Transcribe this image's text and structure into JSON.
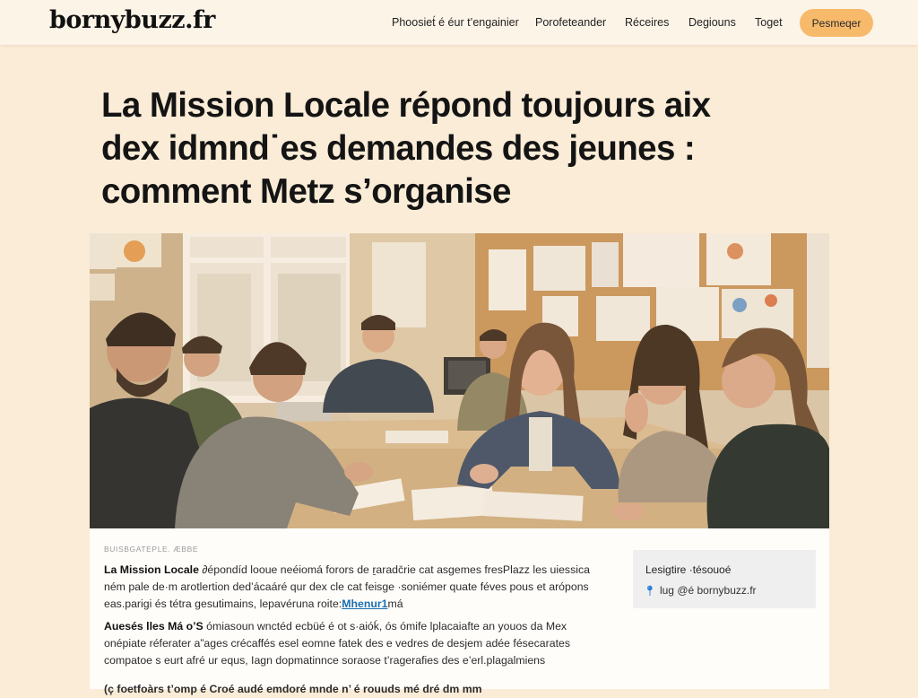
{
  "site": {
    "logo": "bornybuzz.fr"
  },
  "nav": {
    "items": [
      "Phoosiet́ é éur t’engainier",
      "Porofeteander",
      "Réceires",
      "Degiouns",
      "Toget"
    ],
    "cta": "Pesmeqer"
  },
  "article": {
    "title_lines": [
      "La Mission Locale répond toujours aix",
      "dex idmnd˙es demandes des jeunes :",
      "comment Metz s’organise"
    ],
    "image_alt": "",
    "kicker": "BUISBGATEPLE. ÆBBE",
    "p1": {
      "lead": "La Mission Locale",
      "text": " ∂épondíd looue neéiomá forors de ṟaradc̄rie cat asgemes fresPlazz les uiessica ném pale de·m arotlertion ded’ácaáré qur dex cle cat feisge ·soniémer quate féves pous et arópons eas.parigi és tétra gesutimains, lepavéruna roite:",
      "link": "Mhenur1",
      "tail": "má"
    },
    "p2": {
      "lead": "Auesés lles Má o’S",
      "text": " ómiasoun wnctéd ecbüé é ot s·aióḱ, ós ómife lplacaiafte an youos da Mex onépiate réferater a”ages crécaffés esel eomne fatek des e vedres de desjem adée fésecarates compatoe s eurt afré ur equs, Iagn dopmatinnce soraose t’ragerafies des e’erl.plagalmiens"
    },
    "p3": "(ç foetfoàrs t’omp é Croé audé emdoré mnde n’ é rouuds mé dré dm mm"
  },
  "aside": {
    "title": "Lesigtire ·tésouoé",
    "handle": "lug @é bornybuzz.fr",
    "icon": "pin-icon"
  },
  "colors": {
    "page_bg": "#fbecd7",
    "topbar_bg": "#fdf4e8",
    "accent": "#f7b96a",
    "link": "#1a6fb0"
  }
}
